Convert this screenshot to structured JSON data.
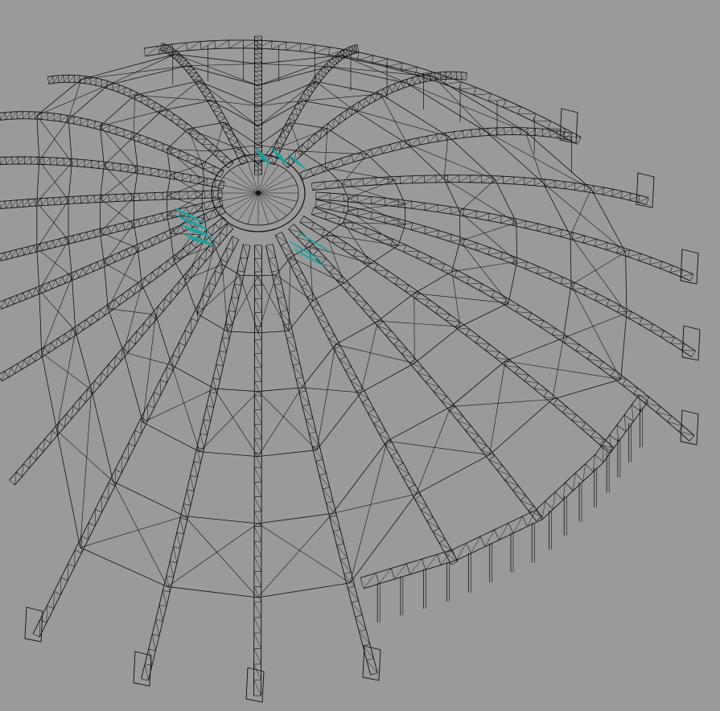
{
  "viewport": {
    "background": "#9a9a9a",
    "wire_color": "#111111",
    "selection_color": "#1aa3a3",
    "model": "wireframe-dome-roof-structure"
  }
}
